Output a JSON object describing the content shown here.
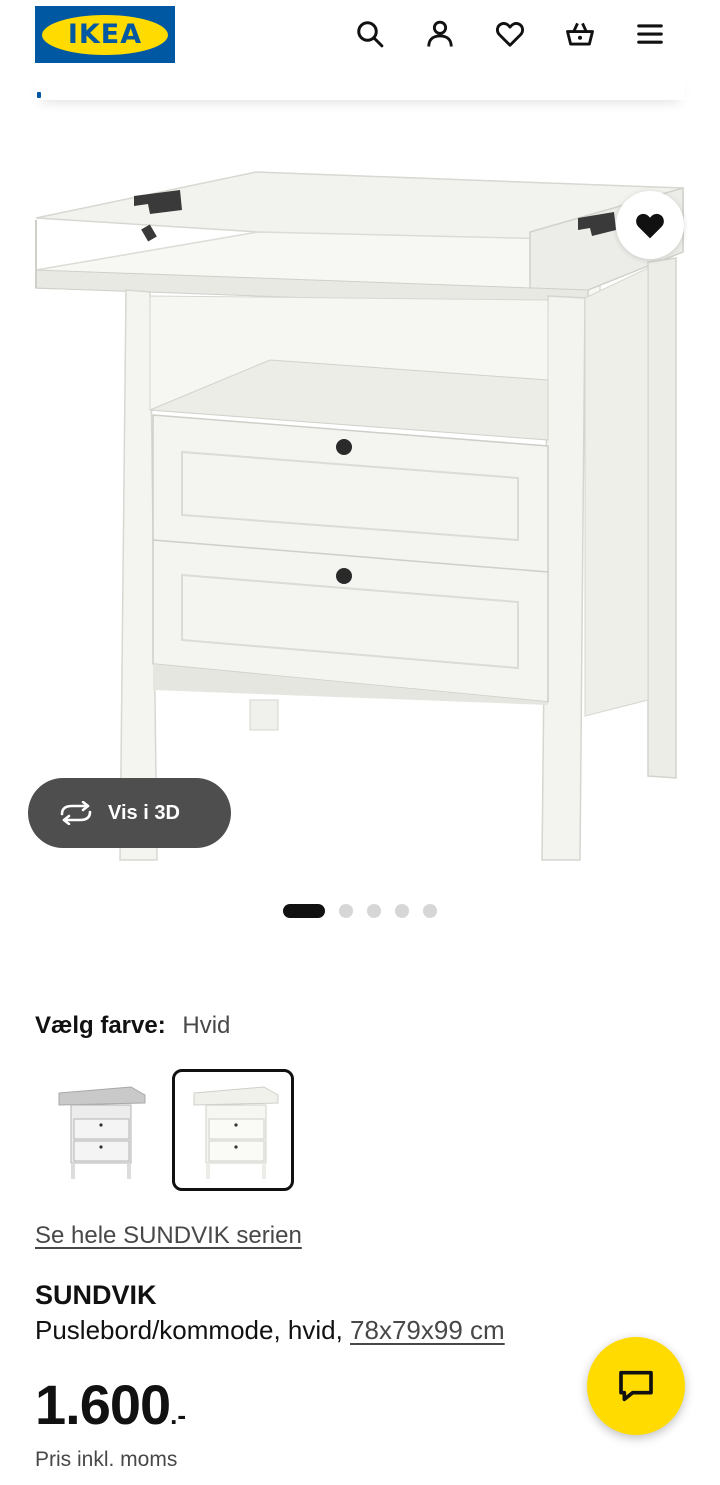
{
  "header": {
    "logo_text": "IKEA",
    "icons": [
      "search-icon",
      "account-icon",
      "heart-icon",
      "basket-icon",
      "menu-icon"
    ]
  },
  "product_image": {
    "alt": "SUNDVIK",
    "view3d_label": "Vis i 3D",
    "carousel": {
      "total": 5,
      "active": 1
    }
  },
  "color": {
    "label": "Vælg farve:",
    "value": "Hvid",
    "swatch_count": 2,
    "selected_index": 1
  },
  "series_link": "Se hele SUNDVIK serien",
  "product": {
    "name": "SUNDVIK",
    "description": "Puslebord/kommode, hvid, ",
    "size": "78x79x99 cm",
    "price": "1.600",
    "price_suffix": ".-",
    "price_note": "Pris inkl. moms"
  },
  "colors": {
    "ikea_blue": "#0058a3",
    "ikea_yellow": "#ffdb00",
    "text": "#111111",
    "muted": "#484848"
  }
}
